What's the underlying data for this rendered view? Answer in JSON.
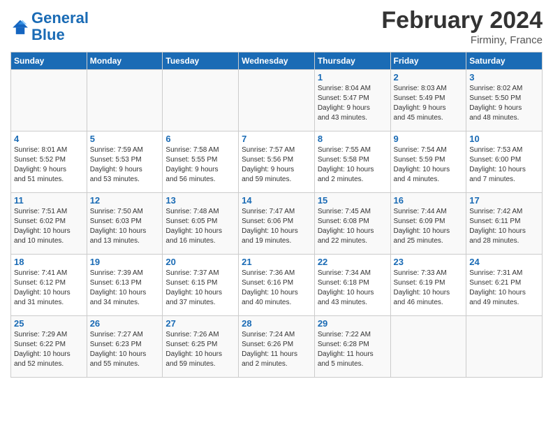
{
  "header": {
    "logo_text_general": "General",
    "logo_text_blue": "Blue",
    "month_title": "February 2024",
    "location": "Firminy, France"
  },
  "days_of_week": [
    "Sunday",
    "Monday",
    "Tuesday",
    "Wednesday",
    "Thursday",
    "Friday",
    "Saturday"
  ],
  "weeks": [
    {
      "cells": [
        {
          "day": "",
          "info": ""
        },
        {
          "day": "",
          "info": ""
        },
        {
          "day": "",
          "info": ""
        },
        {
          "day": "",
          "info": ""
        },
        {
          "day": "1",
          "info": "Sunrise: 8:04 AM\nSunset: 5:47 PM\nDaylight: 9 hours\nand 43 minutes."
        },
        {
          "day": "2",
          "info": "Sunrise: 8:03 AM\nSunset: 5:49 PM\nDaylight: 9 hours\nand 45 minutes."
        },
        {
          "day": "3",
          "info": "Sunrise: 8:02 AM\nSunset: 5:50 PM\nDaylight: 9 hours\nand 48 minutes."
        }
      ]
    },
    {
      "cells": [
        {
          "day": "4",
          "info": "Sunrise: 8:01 AM\nSunset: 5:52 PM\nDaylight: 9 hours\nand 51 minutes."
        },
        {
          "day": "5",
          "info": "Sunrise: 7:59 AM\nSunset: 5:53 PM\nDaylight: 9 hours\nand 53 minutes."
        },
        {
          "day": "6",
          "info": "Sunrise: 7:58 AM\nSunset: 5:55 PM\nDaylight: 9 hours\nand 56 minutes."
        },
        {
          "day": "7",
          "info": "Sunrise: 7:57 AM\nSunset: 5:56 PM\nDaylight: 9 hours\nand 59 minutes."
        },
        {
          "day": "8",
          "info": "Sunrise: 7:55 AM\nSunset: 5:58 PM\nDaylight: 10 hours\nand 2 minutes."
        },
        {
          "day": "9",
          "info": "Sunrise: 7:54 AM\nSunset: 5:59 PM\nDaylight: 10 hours\nand 4 minutes."
        },
        {
          "day": "10",
          "info": "Sunrise: 7:53 AM\nSunset: 6:00 PM\nDaylight: 10 hours\nand 7 minutes."
        }
      ]
    },
    {
      "cells": [
        {
          "day": "11",
          "info": "Sunrise: 7:51 AM\nSunset: 6:02 PM\nDaylight: 10 hours\nand 10 minutes."
        },
        {
          "day": "12",
          "info": "Sunrise: 7:50 AM\nSunset: 6:03 PM\nDaylight: 10 hours\nand 13 minutes."
        },
        {
          "day": "13",
          "info": "Sunrise: 7:48 AM\nSunset: 6:05 PM\nDaylight: 10 hours\nand 16 minutes."
        },
        {
          "day": "14",
          "info": "Sunrise: 7:47 AM\nSunset: 6:06 PM\nDaylight: 10 hours\nand 19 minutes."
        },
        {
          "day": "15",
          "info": "Sunrise: 7:45 AM\nSunset: 6:08 PM\nDaylight: 10 hours\nand 22 minutes."
        },
        {
          "day": "16",
          "info": "Sunrise: 7:44 AM\nSunset: 6:09 PM\nDaylight: 10 hours\nand 25 minutes."
        },
        {
          "day": "17",
          "info": "Sunrise: 7:42 AM\nSunset: 6:11 PM\nDaylight: 10 hours\nand 28 minutes."
        }
      ]
    },
    {
      "cells": [
        {
          "day": "18",
          "info": "Sunrise: 7:41 AM\nSunset: 6:12 PM\nDaylight: 10 hours\nand 31 minutes."
        },
        {
          "day": "19",
          "info": "Sunrise: 7:39 AM\nSunset: 6:13 PM\nDaylight: 10 hours\nand 34 minutes."
        },
        {
          "day": "20",
          "info": "Sunrise: 7:37 AM\nSunset: 6:15 PM\nDaylight: 10 hours\nand 37 minutes."
        },
        {
          "day": "21",
          "info": "Sunrise: 7:36 AM\nSunset: 6:16 PM\nDaylight: 10 hours\nand 40 minutes."
        },
        {
          "day": "22",
          "info": "Sunrise: 7:34 AM\nSunset: 6:18 PM\nDaylight: 10 hours\nand 43 minutes."
        },
        {
          "day": "23",
          "info": "Sunrise: 7:33 AM\nSunset: 6:19 PM\nDaylight: 10 hours\nand 46 minutes."
        },
        {
          "day": "24",
          "info": "Sunrise: 7:31 AM\nSunset: 6:21 PM\nDaylight: 10 hours\nand 49 minutes."
        }
      ]
    },
    {
      "cells": [
        {
          "day": "25",
          "info": "Sunrise: 7:29 AM\nSunset: 6:22 PM\nDaylight: 10 hours\nand 52 minutes."
        },
        {
          "day": "26",
          "info": "Sunrise: 7:27 AM\nSunset: 6:23 PM\nDaylight: 10 hours\nand 55 minutes."
        },
        {
          "day": "27",
          "info": "Sunrise: 7:26 AM\nSunset: 6:25 PM\nDaylight: 10 hours\nand 59 minutes."
        },
        {
          "day": "28",
          "info": "Sunrise: 7:24 AM\nSunset: 6:26 PM\nDaylight: 11 hours\nand 2 minutes."
        },
        {
          "day": "29",
          "info": "Sunrise: 7:22 AM\nSunset: 6:28 PM\nDaylight: 11 hours\nand 5 minutes."
        },
        {
          "day": "",
          "info": ""
        },
        {
          "day": "",
          "info": ""
        }
      ]
    }
  ]
}
